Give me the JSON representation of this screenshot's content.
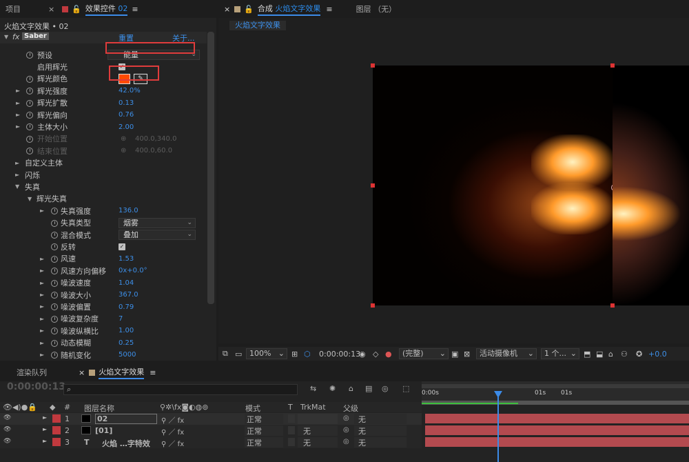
{
  "left_tabs": {
    "project": "项目",
    "effect_controls": "效果控件",
    "effect_controls_target": "02"
  },
  "fx_header": {
    "breadcrumb": "火焰文字效果 • 02",
    "effect_name": "Saber",
    "reset": "重置",
    "about": "关于..."
  },
  "fx_props": {
    "preset_label": "预设",
    "preset_value": "能量",
    "enable_glow": "启用辉光",
    "glow_color": "辉光颜色",
    "glow_color_hex": "#ff4a00",
    "glow_intensity": "辉光强度",
    "glow_intensity_value": "42.0",
    "glow_intensity_unit": "%",
    "glow_spread": "辉光扩散",
    "glow_spread_value": "0.13",
    "glow_bias": "辉光偏向",
    "glow_bias_value": "0.76",
    "core_size": "主体大小",
    "core_size_value": "2.00",
    "start_pos": "开始位置",
    "start_pos_value": "400.0,340.0",
    "end_pos": "结束位置",
    "end_pos_value": "400.0,60.0",
    "custom_core": "自定义主体",
    "flicker": "闪烁",
    "distortion": "失真",
    "glow_distortion": "辉光失真",
    "dist_strength": "失真强度",
    "dist_strength_value": "136.0",
    "dist_type": "失真类型",
    "dist_type_value": "烟雾",
    "blend_mode": "混合模式",
    "blend_mode_value": "叠加",
    "invert": "反转",
    "wind": "风速",
    "wind_value": "1.53",
    "wind_dir": "风速方向偏移",
    "wind_dir_value": "0x+0.0°",
    "noise_speed": "噪波速度",
    "noise_speed_value": "1.04",
    "noise_size": "噪波大小",
    "noise_size_value": "367.0",
    "noise_offset": "噪波偏置",
    "noise_offset_value": "0.79",
    "noise_complexity": "噪波复杂度",
    "noise_complexity_value": "7",
    "noise_aspect": "噪波纵横比",
    "noise_aspect_value": "1.00",
    "motion_blur": "动态模糊",
    "motion_blur_value": "0.25",
    "random": "随机变化",
    "random_value": "5000"
  },
  "viewer_tabs": {
    "comp_prefix": "合成",
    "comp_name": "火焰文字效果",
    "layer": "图层",
    "layer_value": "（无）",
    "sub_tab": "火焰文字效果"
  },
  "viewer_bar": {
    "zoom": "100%",
    "timecode": "0:00:00:13",
    "quality": "(完整)",
    "camera": "活动摄像机",
    "views": "1 个...",
    "exposure": "+0.0"
  },
  "timeline_tabs": {
    "render_queue": "渲染队列",
    "comp": "火焰文字效果"
  },
  "timeline": {
    "timecode": "0:00:00:13",
    "search_placeholder": "",
    "columns": {
      "num": "#",
      "name": "图层名称",
      "mode": "模式",
      "t": "T",
      "trkmat": "TrkMat",
      "parent": "父级"
    },
    "ruler": [
      "0:00s",
      "01s",
      "01s"
    ],
    "layers": [
      {
        "num": "1",
        "name": "02",
        "mode": "正常",
        "trkmat": "",
        "parent": "无",
        "color": "#c0393e"
      },
      {
        "num": "2",
        "name": "[01]",
        "mode": "正常",
        "trkmat": "无",
        "parent": "无",
        "color": "#c0393e"
      },
      {
        "num": "3",
        "name": "火焰 …字特效",
        "mode": "正常",
        "trkmat": "无",
        "parent": "无",
        "color": "#c0393e"
      }
    ]
  },
  "colors": {
    "accent": "#2d8ceb",
    "highlight_box": "#e03c3c",
    "layer_bar": "#b34a4f"
  }
}
